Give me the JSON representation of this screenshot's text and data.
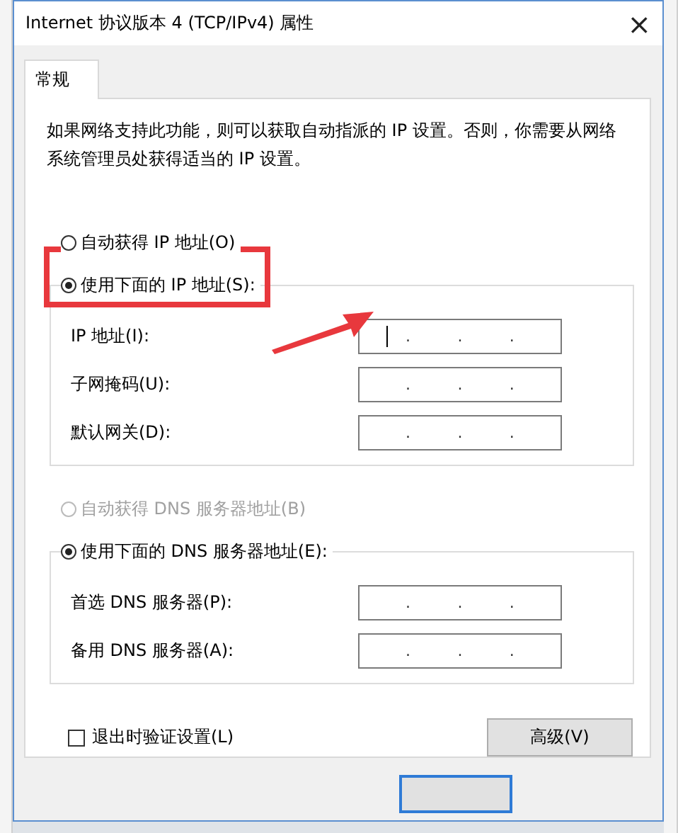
{
  "window": {
    "title": "Internet 协议版本 4 (TCP/IPv4) 属性",
    "close": "×"
  },
  "tabs": [
    {
      "label": "常规",
      "selected": true
    }
  ],
  "description": "如果网络支持此功能，则可以获取自动指派的 IP 设置。否则，你需要从网络系统管理员处获得适当的 IP 设置。",
  "ip_mode": [
    {
      "label": "自动获得 IP 地址(O)",
      "selected": false,
      "disabled": false
    },
    {
      "label": "使用下面的 IP 地址(S):",
      "selected": true,
      "disabled": false
    }
  ],
  "ip_fields": [
    {
      "label": "IP 地址(I):",
      "separator": ".",
      "focused": true
    },
    {
      "label": "子网掩码(U):",
      "separator": ".",
      "focused": false
    },
    {
      "label": "默认网关(D):",
      "separator": ".",
      "focused": false
    }
  ],
  "dns_mode": [
    {
      "label": "自动获得 DNS 服务器地址(B)",
      "selected": false,
      "disabled": true
    },
    {
      "label": "使用下面的 DNS 服务器地址(E):",
      "selected": true,
      "disabled": false
    }
  ],
  "dns_fields": [
    {
      "label": "首选 DNS 服务器(P):",
      "separator": ".",
      "focused": false
    },
    {
      "label": "备用 DNS 服务器(A):",
      "separator": ".",
      "focused": false
    }
  ],
  "validate_on_exit": {
    "label": "退出时验证设置(L)",
    "checked": false
  },
  "advanced_button": "高级(V)",
  "annotations": {
    "highlight": true,
    "arrow": true
  }
}
